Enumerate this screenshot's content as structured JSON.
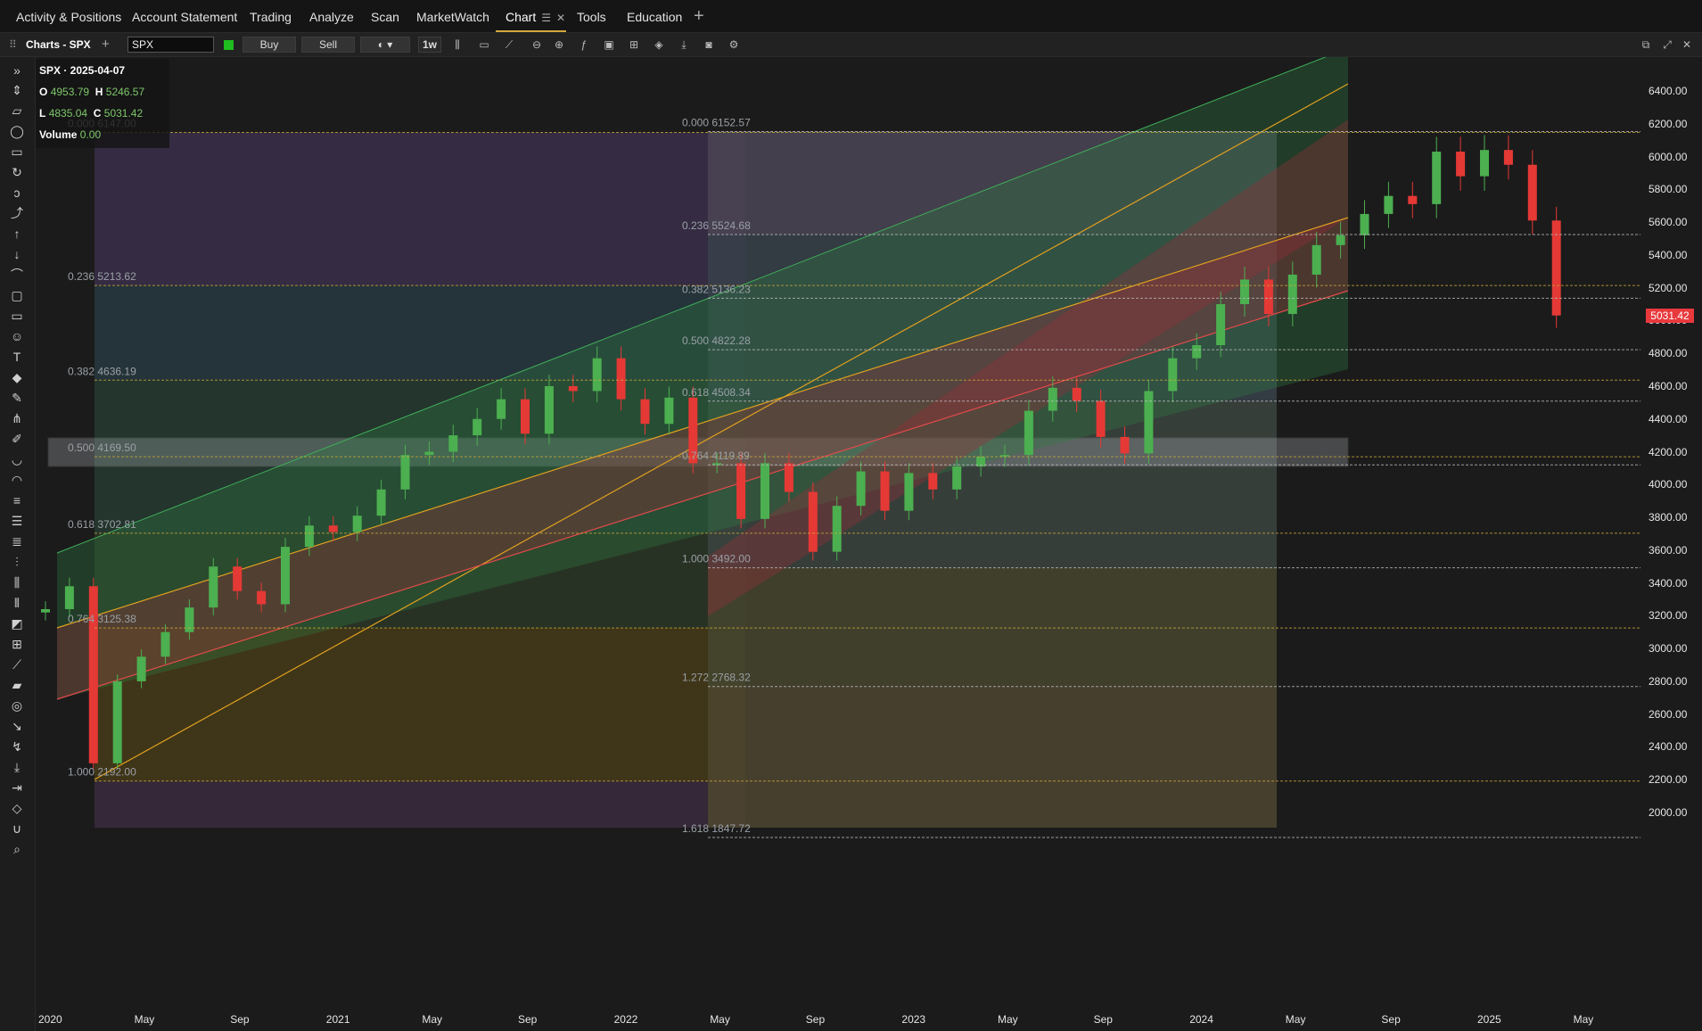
{
  "nav": {
    "tabs": [
      "Activity & Positions",
      "Account Statement",
      "Trading",
      "Analyze",
      "Scan",
      "MarketWatch",
      "Chart",
      "Tools",
      "Education"
    ],
    "active_tab": "Chart",
    "add_tab": "+"
  },
  "toolbar": {
    "title": "Charts - SPX",
    "symbol": "SPX",
    "buy": "Buy",
    "sell": "Sell",
    "timeframe": "1w",
    "link_color": "#1fbd1f"
  },
  "ohlc": {
    "header": "SPX · 2025-04-07",
    "o_label": "O",
    "o": "4953.79",
    "h_label": "H",
    "h": "5246.57",
    "l_label": "L",
    "l": "4835.04",
    "c_label": "C",
    "c": "5031.42",
    "vol_label": "Volume",
    "vol": "0.00"
  },
  "price_axis": [
    "6400.00",
    "6200.00",
    "6000.00",
    "5800.00",
    "5600.00",
    "5400.00",
    "5200.00",
    "5000.00",
    "4800.00",
    "4600.00",
    "4400.00",
    "4200.00",
    "4000.00",
    "3800.00",
    "3600.00",
    "3400.00",
    "3200.00",
    "3000.00",
    "2800.00",
    "2600.00",
    "2400.00",
    "2200.00",
    "2000.00"
  ],
  "last_price": "5031.42",
  "date_axis": [
    "2020",
    "May",
    "Sep",
    "2021",
    "May",
    "Sep",
    "2022",
    "May",
    "Sep",
    "2023",
    "May",
    "Sep",
    "2024",
    "May",
    "Sep",
    "2025",
    "May"
  ],
  "fib_left": [
    {
      "ratio": "0.000",
      "price": "6147.00"
    },
    {
      "ratio": "0.236",
      "price": "5213.62"
    },
    {
      "ratio": "0.382",
      "price": "4636.19"
    },
    {
      "ratio": "0.500",
      "price": "4169.50"
    },
    {
      "ratio": "0.618",
      "price": "3702.81"
    },
    {
      "ratio": "0.764",
      "price": "3125.38"
    },
    {
      "ratio": "1.000",
      "price": "2192.00"
    }
  ],
  "fib_right": [
    {
      "ratio": "0.000",
      "price": "6152.57"
    },
    {
      "ratio": "0.236",
      "price": "5524.68"
    },
    {
      "ratio": "0.382",
      "price": "5136.23"
    },
    {
      "ratio": "0.500",
      "price": "4822.28"
    },
    {
      "ratio": "0.618",
      "price": "4508.34"
    },
    {
      "ratio": "0.764",
      "price": "4119.89"
    },
    {
      "ratio": "1.000",
      "price": "3492.00"
    },
    {
      "ratio": "1.272",
      "price": "2768.32"
    },
    {
      "ratio": "1.618",
      "price": "1847.72"
    }
  ],
  "colors": {
    "up": "#4caf50",
    "down": "#e53935",
    "accent": "#d3a83c",
    "last": "#e8393d"
  },
  "chart_data": {
    "type": "candlestick",
    "title": "SPX · 2025-04-07",
    "interval": "1w",
    "ylim": [
      1900,
      6500
    ],
    "x_range": [
      "2020-01",
      "2025-05"
    ],
    "series": [
      {
        "values": [
          [
            "2020-01",
            3240
          ],
          [
            "2020-02",
            3380
          ],
          [
            "2020-03",
            2300
          ],
          [
            "2020-04",
            2800
          ],
          [
            "2020-05",
            2950
          ],
          [
            "2020-06",
            3100
          ],
          [
            "2020-07",
            3250
          ],
          [
            "2020-08",
            3500
          ],
          [
            "2020-09",
            3350
          ],
          [
            "2020-10",
            3270
          ],
          [
            "2020-11",
            3620
          ],
          [
            "2020-12",
            3750
          ],
          [
            "2021-01",
            3710
          ],
          [
            "2021-02",
            3810
          ],
          [
            "2021-03",
            3970
          ],
          [
            "2021-04",
            4180
          ],
          [
            "2021-05",
            4200
          ],
          [
            "2021-06",
            4300
          ],
          [
            "2021-07",
            4400
          ],
          [
            "2021-08",
            4520
          ],
          [
            "2021-09",
            4310
          ],
          [
            "2021-10",
            4600
          ],
          [
            "2021-11",
            4570
          ],
          [
            "2021-12",
            4770
          ],
          [
            "2022-01",
            4520
          ],
          [
            "2022-02",
            4370
          ],
          [
            "2022-03",
            4530
          ],
          [
            "2022-04",
            4130
          ],
          [
            "2022-05",
            4130
          ],
          [
            "2022-06",
            3790
          ],
          [
            "2022-07",
            4130
          ],
          [
            "2022-08",
            3955
          ],
          [
            "2022-09",
            3590
          ],
          [
            "2022-10",
            3870
          ],
          [
            "2022-11",
            4080
          ],
          [
            "2022-12",
            3840
          ],
          [
            "2023-01",
            4070
          ],
          [
            "2023-02",
            3970
          ],
          [
            "2023-03",
            4110
          ],
          [
            "2023-04",
            4170
          ],
          [
            "2023-05",
            4180
          ],
          [
            "2023-06",
            4450
          ],
          [
            "2023-07",
            4590
          ],
          [
            "2023-08",
            4510
          ],
          [
            "2023-09",
            4290
          ],
          [
            "2023-10",
            4190
          ],
          [
            "2023-11",
            4570
          ],
          [
            "2023-12",
            4770
          ],
          [
            "2024-01",
            4850
          ],
          [
            "2024-02",
            5100
          ],
          [
            "2024-03",
            5250
          ],
          [
            "2024-04",
            5040
          ],
          [
            "2024-05",
            5280
          ],
          [
            "2024-06",
            5460
          ],
          [
            "2024-07",
            5520
          ],
          [
            "2024-08",
            5650
          ],
          [
            "2024-09",
            5760
          ],
          [
            "2024-10",
            5710
          ],
          [
            "2024-11",
            6030
          ],
          [
            "2024-12",
            5880
          ],
          [
            "2025-01",
            6040
          ],
          [
            "2025-02",
            5950
          ],
          [
            "2025-03",
            5610
          ],
          [
            "2025-04",
            5031
          ]
        ]
      }
    ],
    "last": {
      "date": "2025-04-07",
      "open": 4953.79,
      "high": 5246.57,
      "low": 4835.04,
      "close": 5031.42
    }
  }
}
